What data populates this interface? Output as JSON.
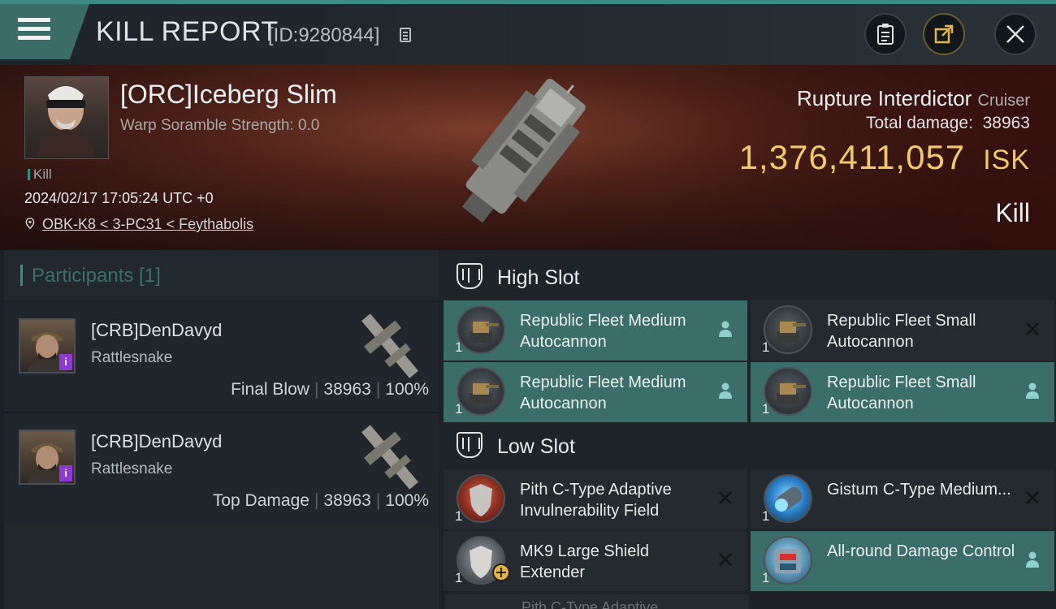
{
  "header": {
    "title": "KILL REPORT",
    "report_id": "[ID:9280844]"
  },
  "victim": {
    "name": "[ORC]Iceberg Slim",
    "warp_scramble": "Warp Soramble Strength: 0.0",
    "kill_tag": "Kill",
    "datetime": "2024/02/17 17:05:24 UTC +0",
    "location": "OBK-K8 < 3-PC31 < Feythabolis",
    "ship_name": "Rupture Interdictor",
    "ship_class": "Cruiser",
    "total_damage_label": "Total damage:",
    "total_damage": "38963",
    "isk_value": "1,376,411,057",
    "isk_unit": "ISK",
    "result": "Kill"
  },
  "participants": {
    "label": "Participants [1]",
    "rows": [
      {
        "name": "[CRB]DenDavyd",
        "ship": "Rattlesnake",
        "role": "Final Blow",
        "damage": "38963",
        "percent": "100%",
        "badge": "i"
      },
      {
        "name": "[CRB]DenDavyd",
        "ship": "Rattlesnake",
        "role": "Top Damage",
        "damage": "38963",
        "percent": "100%",
        "badge": "i"
      }
    ]
  },
  "slots": {
    "high": {
      "label": "High Slot",
      "items": [
        {
          "name": "Republic Fleet Medium Autocannon",
          "qty": "1",
          "state": "fitted"
        },
        {
          "name": "Republic Fleet Small Autocannon",
          "qty": "1",
          "state": "destroyed"
        },
        {
          "name": "Republic Fleet Medium Autocannon",
          "qty": "1",
          "state": "fitted"
        },
        {
          "name": "Republic Fleet Small Autocannon",
          "qty": "1",
          "state": "fitted"
        }
      ]
    },
    "low": {
      "label": "Low Slot",
      "items": [
        {
          "name": "Pith C-Type Adaptive Invulnerability Field",
          "qty": "1",
          "state": "destroyed"
        },
        {
          "name": "Gistum C-Type Medium...",
          "qty": "1",
          "state": "destroyed"
        },
        {
          "name": "MK9 Large Shield Extender",
          "qty": "1",
          "state": "destroyed"
        },
        {
          "name": "All-round Damage Control",
          "qty": "1",
          "state": "fitted"
        }
      ]
    },
    "partial_item": "Pith C-Type Adaptive"
  },
  "colors": {
    "accent": "#3d8b82",
    "fitted_bg": "#3b6e69",
    "isk_gold": "#f0c96a"
  },
  "icons": {
    "menu": "hamburger-menu-icon",
    "copy": "copy-icon",
    "clipboard": "clipboard-icon",
    "share": "share-icon",
    "close": "close-icon",
    "location": "location-pin-icon",
    "slot": "module-slot-icon",
    "dropped": "person-icon",
    "destroyed": "x-icon"
  }
}
